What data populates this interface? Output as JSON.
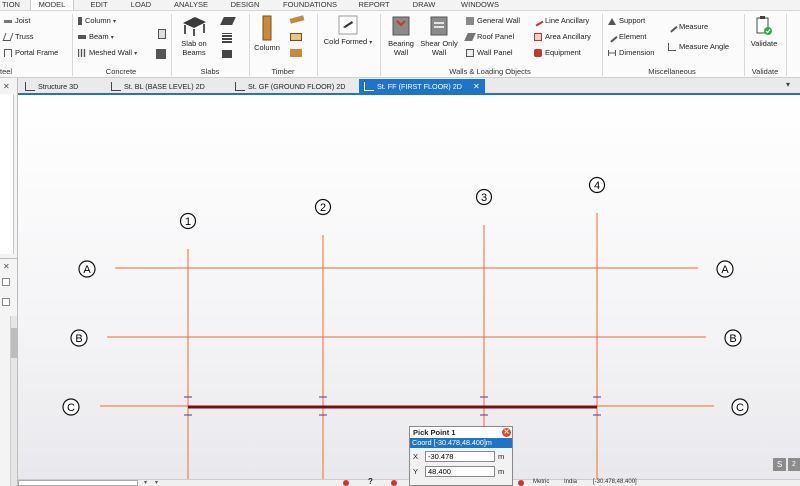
{
  "menu": {
    "tabs": [
      {
        "label": "TION"
      },
      {
        "label": "MODEL"
      },
      {
        "label": "EDIT"
      },
      {
        "label": "LOAD"
      },
      {
        "label": "ANALYSE"
      },
      {
        "label": "DESIGN"
      },
      {
        "label": "FOUNDATIONS"
      },
      {
        "label": "REPORT"
      },
      {
        "label": "DRAW"
      },
      {
        "label": "WINDOWS"
      }
    ],
    "active_index": 1
  },
  "ribbon": {
    "groups": {
      "steel": "teel",
      "concrete": "Concrete",
      "slabs": "Slabs",
      "timber": "Timber",
      "walls": "Walls & Loading Objects",
      "misc": "Miscellaneous",
      "validate": "Validate"
    },
    "steel_items": [
      "Joist",
      "Truss",
      "Portal Frame"
    ],
    "concrete_items": [
      "Column",
      "Beam",
      "Meshed Wall"
    ],
    "slab_on_beams": "Slab on Beams",
    "timber_column": "Column",
    "cold_formed": "Cold Formed",
    "bearing_wall": "Bearing Wall",
    "shear_wall": "Shear Only Wall",
    "wall_items": [
      "General Wall",
      "Roof Panel",
      "Wall Panel"
    ],
    "ancillary_items": [
      "Line Ancillary",
      "Area Ancillary",
      "Equipment"
    ],
    "misc_items": [
      "Support",
      "Element",
      "Dimension"
    ],
    "measure_items": [
      "Measure",
      "Measure Angle"
    ],
    "validate_btn": "Validate"
  },
  "doc_tabs": [
    {
      "label": "Structure 3D"
    },
    {
      "label": "St. BL (BASE LEVEL) 2D"
    },
    {
      "label": "St. GF (GROUND FLOOR) 2D"
    },
    {
      "label": "St. FF (FIRST FLOOR) 2D"
    }
  ],
  "active_doc_tab": 3,
  "grid": {
    "columns": [
      "1",
      "2",
      "3",
      "4"
    ],
    "rows": [
      "A",
      "B",
      "C"
    ]
  },
  "pick_point": {
    "title": "Pick Point 1",
    "coord": "Coord [-30.478,48.400]m",
    "x_label": "X",
    "x_value": "-30.478",
    "y_label": "Y",
    "y_value": "48.400",
    "unit": "m"
  },
  "status": {
    "units": "Metric",
    "region": "India",
    "coords": "[-30.478,48.400]"
  },
  "colors": {
    "accent": "#1d74c9",
    "gridline": "#ef6a2e",
    "beam": "#7a0f0f"
  }
}
